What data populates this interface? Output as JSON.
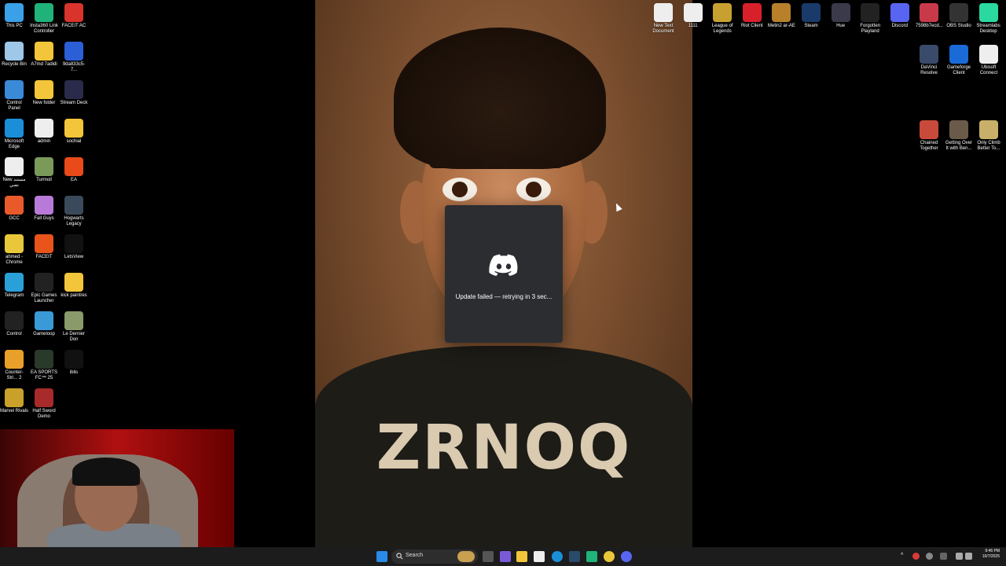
{
  "discord_popup": {
    "message": "Update failed — retrying in 3 sec..."
  },
  "wallpaper": {
    "shirt_text": "ZRNOQ"
  },
  "left_icons": [
    {
      "label": "This PC",
      "color": "#3aa0e8"
    },
    {
      "label": "Insta360 Link Controller",
      "color": "#1fb37a"
    },
    {
      "label": "FACEIT AC",
      "color": "#d8342c"
    },
    {
      "label": "Recycle Bin",
      "color": "#9fc7e8"
    },
    {
      "label": "A7md 7adidi",
      "color": "#f2c53a"
    },
    {
      "label": "9da833c5-7...",
      "color": "#2a5fd8"
    },
    {
      "label": "Control Panel",
      "color": "#3a8ad8"
    },
    {
      "label": "New folder",
      "color": "#f2c53a"
    },
    {
      "label": "Stream Deck",
      "color": "#2a2a4a"
    },
    {
      "label": "Microsoft Edge",
      "color": "#1a8fd8"
    },
    {
      "label": "admin",
      "color": "#eeeeee"
    },
    {
      "label": "sochial",
      "color": "#f2c53a"
    },
    {
      "label": "New مستند نصي",
      "color": "#eeeeee"
    },
    {
      "label": "Turmoil",
      "color": "#7a9a5a"
    },
    {
      "label": "EA",
      "color": "#e84a1a"
    },
    {
      "label": "GCC",
      "color": "#e85a2a"
    },
    {
      "label": "Fall Guys",
      "color": "#b87ad8"
    },
    {
      "label": "Hogwarts Legacy",
      "color": "#3a4a5a"
    },
    {
      "label": "ahmed - Chrome",
      "color": "#e8c83a"
    },
    {
      "label": "FACEIT",
      "color": "#e8541a"
    },
    {
      "label": "LetsView",
      "color": "#111111"
    },
    {
      "label": "Telegram",
      "color": "#2aa0d8"
    },
    {
      "label": "Epic Games Launcher",
      "color": "#222222"
    },
    {
      "label": "kick paintres",
      "color": "#f2c53a"
    },
    {
      "label": "Control",
      "color": "#222222"
    },
    {
      "label": "Gameloop",
      "color": "#3a9ad8"
    },
    {
      "label": "Le Dernier Don",
      "color": "#8a9a6a"
    },
    {
      "label": "Counter-Stri... 2",
      "color": "#e8a02a"
    },
    {
      "label": "EA SPORTS FC™ 25",
      "color": "#2a3a2a"
    },
    {
      "label": "iblis",
      "color": "#111111"
    },
    {
      "label": "Marvel Rivals",
      "color": "#c8a02a"
    },
    {
      "label": "Half Sword Demo",
      "color": "#a82a2a"
    }
  ],
  "top_icons": [
    {
      "label": "New Text Document",
      "color": "#eeeeee"
    },
    {
      "label": "1111",
      "color": "#eeeeee"
    },
    {
      "label": "League of Legends",
      "color": "#c8a030"
    },
    {
      "label": "Riot Client",
      "color": "#d8202a"
    },
    {
      "label": "Metin2 ar-AE",
      "color": "#b8802a"
    },
    {
      "label": "Steam",
      "color": "#1a3a6a"
    },
    {
      "label": "Hue",
      "color": "#3a3a4a"
    },
    {
      "label": "Forgotten Playland",
      "color": "#222222"
    },
    {
      "label": "Discord",
      "color": "#5865f2"
    },
    {
      "label": "7598b7ecd...",
      "color": "#c83a4a"
    },
    {
      "label": "OBS Studio",
      "color": "#333333"
    },
    {
      "label": "Streamlabs Desktop",
      "color": "#2ad8a0"
    }
  ],
  "right_icons": [
    {
      "label": "DaVinci Resolve",
      "color": "#3a4a6a"
    },
    {
      "label": "Gameforge Client",
      "color": "#1a6ad8"
    },
    {
      "label": "Ubisoft Connect",
      "color": "#eeeeee"
    },
    {
      "label": "Chained Together",
      "color": "#c84a3a"
    },
    {
      "label": "Getting Over It with Ben...",
      "color": "#6a5a4a"
    },
    {
      "label": "Only Climb Better To...",
      "color": "#c8b06a"
    }
  ],
  "taskbar": {
    "search_placeholder": "Search",
    "time": "9:46 PM",
    "date": "10/7/2025"
  }
}
